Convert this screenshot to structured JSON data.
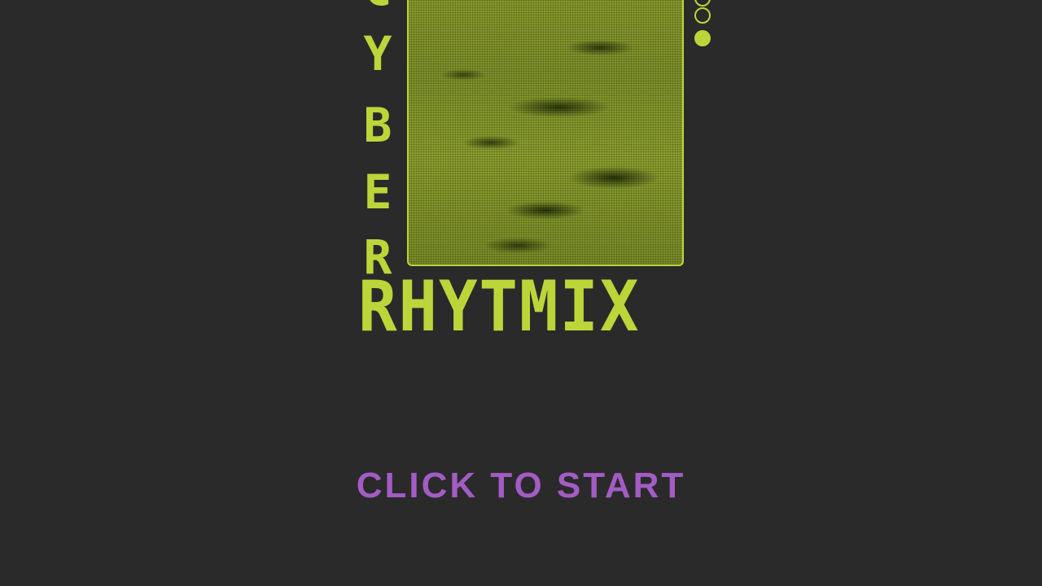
{
  "title": {
    "vertical_letters": [
      "C",
      "Y",
      "B",
      "E",
      "R"
    ],
    "horizontal": "RHYTMIX"
  },
  "cover_art": {
    "description_icon": "halftone-lunar-surface-image"
  },
  "indicators": {
    "dots": [
      "hollow",
      "hollow",
      "filled"
    ]
  },
  "start_prompt": "CLICK TO START",
  "colors": {
    "background": "#2a2a2a",
    "accent_lime": "#bcd63a",
    "accent_purple": "#a35cc4"
  }
}
